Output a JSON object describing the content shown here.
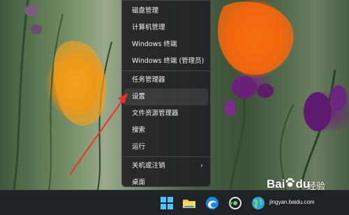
{
  "context_menu": {
    "items": [
      {
        "label": "磁盘管理"
      },
      {
        "label": "计算机管理"
      },
      {
        "label": "Windows 终端"
      },
      {
        "label": "Windows 终端 (管理员)"
      },
      {
        "label": "任务管理器"
      },
      {
        "label": "设置",
        "highlighted": true
      },
      {
        "label": "文件资源管理器"
      },
      {
        "label": "搜索"
      },
      {
        "label": "运行"
      },
      {
        "label": "关机或注销",
        "submenu_icon": "chevron-right-icon"
      },
      {
        "label": "桌面"
      }
    ]
  },
  "taskbar": {
    "icons": [
      "windows-start-icon",
      "file-explorer-icon",
      "edge-browser-icon",
      "media-app-icon",
      "globe-browser-icon"
    ]
  },
  "watermark": {
    "brand": "Bai",
    "brand_suffix": "du",
    "word": "经验",
    "url": "jingyan.baidu.com"
  },
  "annotation": {
    "color": "#e8342a"
  }
}
